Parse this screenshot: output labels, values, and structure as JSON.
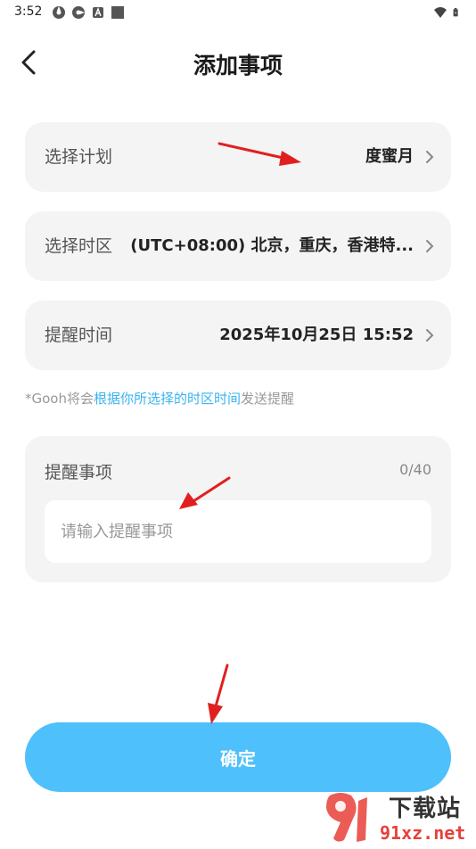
{
  "status_bar": {
    "time": "3:52"
  },
  "header": {
    "title": "添加事项"
  },
  "plan_row": {
    "label": "选择计划",
    "value": "度蜜月"
  },
  "timezone_row": {
    "label": "选择时区",
    "value": "(UTC+08:00) 北京，重庆，香港特..."
  },
  "time_row": {
    "label": "提醒时间",
    "value": "2025年10月25日 15:52"
  },
  "hint": {
    "prefix": "*Gooh将会",
    "link": "根据你所选择的时区时间",
    "suffix": "发送提醒"
  },
  "reminder": {
    "label": "提醒事项",
    "count": "0/40",
    "placeholder": "请输入提醒事项",
    "value": ""
  },
  "confirm_button": {
    "label": "确定"
  },
  "watermark": {
    "logo_text": "下载站",
    "site": "91xz.net"
  },
  "colors": {
    "accent": "#4ec0fb",
    "link": "#3bb3ee",
    "card_bg": "#f4f4f4",
    "annotation": "#e02020"
  }
}
